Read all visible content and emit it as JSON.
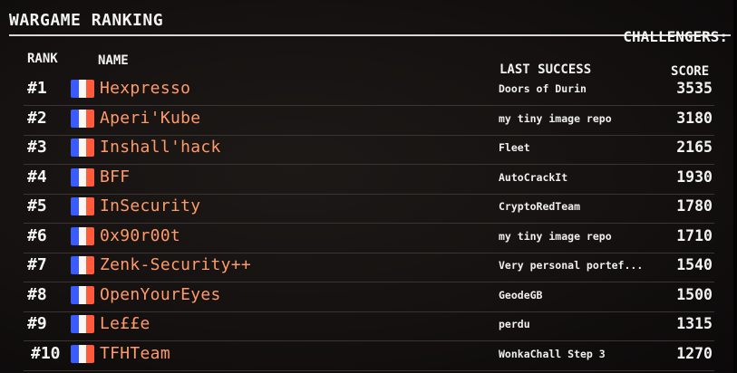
{
  "header": {
    "title": "WARGAME RANKING",
    "challengers_label": "CHALLENGERS:"
  },
  "columns": {
    "rank": "RANK",
    "name": "NAME",
    "last_success": "LAST SUCCESS",
    "score": "SCORE"
  },
  "flag_colors": [
    "#3a5cff",
    "#fbf8f4",
    "#ff5a3c"
  ],
  "name_color": "#ff9a6a",
  "icons": {
    "flag": "france-flag-icon"
  },
  "rows": [
    {
      "rank": "#1",
      "name": "Hexpresso",
      "last": "Doors of Durin",
      "score": "3535"
    },
    {
      "rank": "#2",
      "name": "Aperi'Kube",
      "last": "my tiny image repo",
      "score": "3180"
    },
    {
      "rank": "#3",
      "name": "Inshall'hack",
      "last": "Fleet",
      "score": "2165"
    },
    {
      "rank": "#4",
      "name": "BFF",
      "last": "AutoCrackIt",
      "score": "1930"
    },
    {
      "rank": "#5",
      "name": "InSecurity",
      "last": "CryptoRedTeam",
      "score": "1780"
    },
    {
      "rank": "#6",
      "name": "0x90r00t",
      "last": "my tiny image repo",
      "score": "1710"
    },
    {
      "rank": "#7",
      "name": "Zenk-Security++",
      "last": "Very personal portef...",
      "score": "1540"
    },
    {
      "rank": "#8",
      "name": "OpenYourEyes",
      "last": "GeodeGB",
      "score": "1500"
    },
    {
      "rank": "#9",
      "name": "Le££e",
      "last": "perdu",
      "score": "1315"
    },
    {
      "rank": "#10",
      "name": "TFHTeam",
      "last": "WonkaChall Step 3",
      "score": "1270"
    }
  ]
}
